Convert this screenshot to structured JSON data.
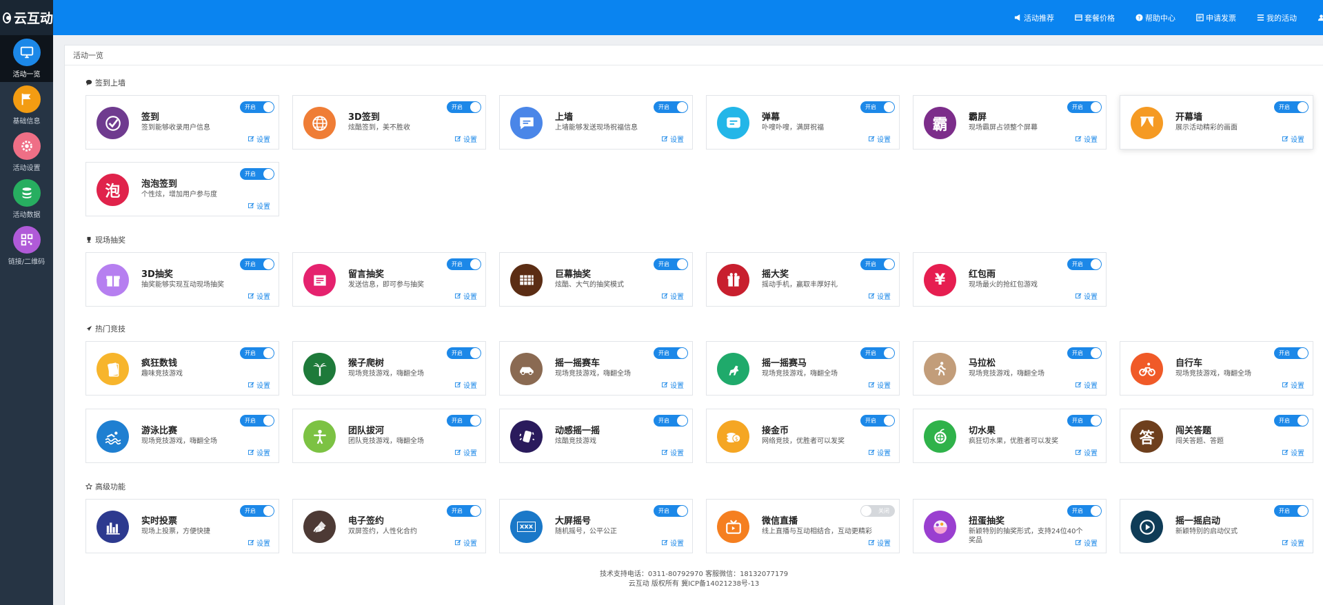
{
  "app": {
    "logo_text": "云互动"
  },
  "sidebar": {
    "items": [
      {
        "label": "活动一览",
        "icon": "monitor-icon",
        "color": "#1c88e8"
      },
      {
        "label": "基础信息",
        "icon": "flag-icon",
        "color": "#f39c12"
      },
      {
        "label": "活动设置",
        "icon": "gear-icon",
        "color": "#ef6f86"
      },
      {
        "label": "活动数据",
        "icon": "database-icon",
        "color": "#27ae60"
      },
      {
        "label": "链接/二维码",
        "icon": "qrcode-icon",
        "color": "#b05ad8"
      }
    ]
  },
  "topnav": {
    "items": [
      {
        "label": "活动推荐",
        "icon": "megaphone-icon"
      },
      {
        "label": "套餐价格",
        "icon": "card-icon"
      },
      {
        "label": "帮助中心",
        "icon": "help-icon"
      },
      {
        "label": "申请发票",
        "icon": "invoice-icon"
      },
      {
        "label": "我的活动",
        "icon": "list-icon"
      }
    ]
  },
  "page": {
    "header": "活动一览"
  },
  "toggle_labels": {
    "on": "开启",
    "off": "关闭"
  },
  "setting_label": "设置",
  "sections": [
    {
      "title": "签到上墙",
      "icon": "comment-icon",
      "cards": [
        {
          "title": "签到",
          "desc": "签到能够收录用户信息",
          "color": "#6f3b8f",
          "icon": "check-icon",
          "on": true
        },
        {
          "title": "3D签到",
          "desc": "炫酷签到，美不胜收",
          "color": "#ef7d36",
          "icon": "globe-icon",
          "on": true
        },
        {
          "title": "上墙",
          "desc": "上墙能够发送现场祝福信息",
          "color": "#4a86e8",
          "icon": "chat-icon",
          "on": true
        },
        {
          "title": "弹幕",
          "desc": "卟嗖卟嗖，满屏祝福",
          "color": "#23b6e8",
          "icon": "barrage-icon",
          "on": true
        },
        {
          "title": "霸屏",
          "desc": "现场霸屏占领整个屏幕",
          "color": "#7c2d8a",
          "icon": "ba-icon",
          "icon_text": "霸",
          "on": true
        },
        {
          "title": "开幕墙",
          "desc": "展示活动精彩的画面",
          "color": "#f59a23",
          "icon": "curtain-icon",
          "on": true,
          "highlight": true
        },
        {
          "title": "泡泡签到",
          "desc": "个性炫，增加用户参与度",
          "color": "#e0234b",
          "icon": "bubble-icon",
          "icon_text": "泡",
          "on": true
        }
      ]
    },
    {
      "title": "现场抽奖",
      "icon": "trophy-icon",
      "cards": [
        {
          "title": "3D抽奖",
          "desc": "抽奖能够实现互动现场抽奖",
          "color": "#b67ff0",
          "icon": "gift-icon",
          "on": true
        },
        {
          "title": "留言抽奖",
          "desc": "发送信息，即可参与抽奖",
          "color": "#e5226e",
          "icon": "message-icon",
          "on": true
        },
        {
          "title": "巨幕抽奖",
          "desc": "炫酷、大气的抽奖模式",
          "color": "#5b2d14",
          "icon": "screen-icon",
          "on": true
        },
        {
          "title": "摇大奖",
          "desc": "摇动手机，赢取丰厚好礼",
          "color": "#c81f2e",
          "icon": "prize-icon",
          "on": true
        },
        {
          "title": "红包雨",
          "desc": "现场最火的抢红包游戏",
          "color": "#e61e50",
          "icon": "redpacket-icon",
          "icon_text": "¥",
          "on": true
        }
      ]
    },
    {
      "title": "热门竞技",
      "icon": "rocket-icon",
      "cards": [
        {
          "title": "疯狂数钱",
          "desc": "趣味竞技游戏",
          "color": "#f7b52c",
          "icon": "money-icon",
          "on": true
        },
        {
          "title": "猴子爬树",
          "desc": "现场竞技游戏，嗨翻全场",
          "color": "#1e7a3a",
          "icon": "palm-icon",
          "on": true
        },
        {
          "title": "摇一摇赛车",
          "desc": "现场竞技游戏，嗨翻全场",
          "color": "#8a6a52",
          "icon": "car-icon",
          "on": true
        },
        {
          "title": "摇一摇赛马",
          "desc": "现场竞技游戏，嗨翻全场",
          "color": "#1faa6b",
          "icon": "horse-icon",
          "on": true
        },
        {
          "title": "马拉松",
          "desc": "现场竞技游戏，嗨翻全场",
          "color": "#c29d7a",
          "icon": "runner-icon",
          "on": true
        },
        {
          "title": "自行车",
          "desc": "现场竞技游戏，嗨翻全场",
          "color": "#f05a28",
          "icon": "bike-icon",
          "on": true
        },
        {
          "title": "游泳比赛",
          "desc": "现场竞技游戏，嗨翻全场",
          "color": "#1f7fd1",
          "icon": "swim-icon",
          "on": true
        },
        {
          "title": "团队拔河",
          "desc": "团队竞技游戏，嗨翻全场",
          "color": "#7cc243",
          "icon": "tug-icon",
          "on": true
        },
        {
          "title": "动感摇一摇",
          "desc": "炫酷竞技游戏",
          "color": "#2a1b5c",
          "icon": "shake-icon",
          "on": true
        },
        {
          "title": "接金币",
          "desc": "网络竞技，优胜者可以发奖",
          "color": "#f5a623",
          "icon": "coin-icon",
          "on": true
        },
        {
          "title": "切水果",
          "desc": "疯狂切水果，优胜者可以发奖",
          "color": "#2fb24a",
          "icon": "fruit-icon",
          "on": true
        },
        {
          "title": "闯关答题",
          "desc": "闯关答题、答题",
          "color": "#6e3f1d",
          "icon": "quiz-icon",
          "icon_text": "答",
          "on": true
        }
      ]
    },
    {
      "title": "高级功能",
      "icon": "star-icon",
      "cards": [
        {
          "title": "实时投票",
          "desc": "现场上投票，方便快捷",
          "color": "#2d3a8f",
          "icon": "vote-icon",
          "on": true
        },
        {
          "title": "电子签约",
          "desc": "双屏签约，人性化合约",
          "color": "#4d3a35",
          "icon": "sign-icon",
          "on": true
        },
        {
          "title": "大屏摇号",
          "desc": "随机摇号，公平公正",
          "color": "#1a78c8",
          "icon": "lottery-icon",
          "icon_text": "xxx",
          "on": true
        },
        {
          "title": "微信直播",
          "desc": "线上直播与互动相结合，互动更精彩",
          "color": "#f57f20",
          "icon": "tv-icon",
          "on": false
        },
        {
          "title": "扭蛋抽奖",
          "desc": "新颖特别的抽奖形式，支持24位40个奖品",
          "color": "#9a3fd0",
          "icon": "capsule-icon",
          "on": true
        },
        {
          "title": "摇一摇启动",
          "desc": "新颖特别的启动仪式",
          "color": "#0f3c57",
          "icon": "play-icon",
          "on": true
        }
      ]
    }
  ],
  "footer": {
    "line1": "技术支持电话：0311-80792970 客服微信：18132077179",
    "line2": "云互动 版权所有 冀ICP备14021238号-13"
  }
}
